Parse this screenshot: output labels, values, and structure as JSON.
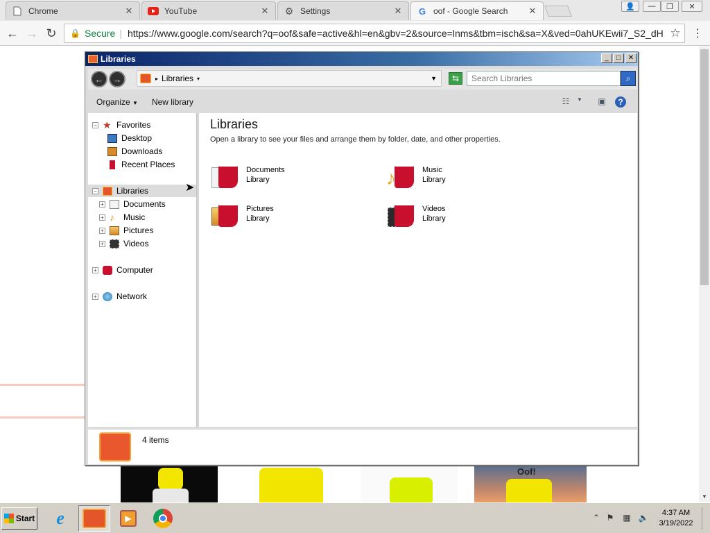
{
  "browser": {
    "tabs": [
      {
        "title": "Chrome",
        "icon": "page-icon",
        "active": false
      },
      {
        "title": "YouTube",
        "icon": "youtube-icon",
        "active": false
      },
      {
        "title": "Settings",
        "icon": "gear-icon",
        "active": false
      },
      {
        "title": "oof - Google Search",
        "icon": "google-icon",
        "active": true
      }
    ],
    "address": {
      "secure_label": "Secure",
      "url": "https://www.google.com/search?q=oof&safe=active&hl=en&gbv=2&source=lnms&tbm=isch&sa=X&ved=0ahUKEwii7_S2_dH"
    },
    "accent": "#0b8043"
  },
  "explorer": {
    "title": "Libraries",
    "breadcrumb": "Libraries",
    "search_placeholder": "Search Libraries",
    "commands": {
      "organize": "Organize",
      "new_library": "New library"
    },
    "nav": {
      "favorites": "Favorites",
      "desktop": "Desktop",
      "downloads": "Downloads",
      "recent_places": "Recent Places",
      "libraries": "Libraries",
      "documents": "Documents",
      "music": "Music",
      "pictures": "Pictures",
      "videos": "Videos",
      "computer": "Computer",
      "network": "Network"
    },
    "heading": "Libraries",
    "description": "Open a library to see your files and arrange them by folder, date, and other properties.",
    "libraries": [
      {
        "name": "Documents",
        "type": "Library"
      },
      {
        "name": "Music",
        "type": "Library"
      },
      {
        "name": "Pictures",
        "type": "Library"
      },
      {
        "name": "Videos",
        "type": "Library"
      }
    ],
    "status": "4 items"
  },
  "page": {
    "thumb_text": "Oof!"
  },
  "taskbar": {
    "start_label": "Start",
    "time": "4:37 AM",
    "date": "3/19/2022"
  }
}
